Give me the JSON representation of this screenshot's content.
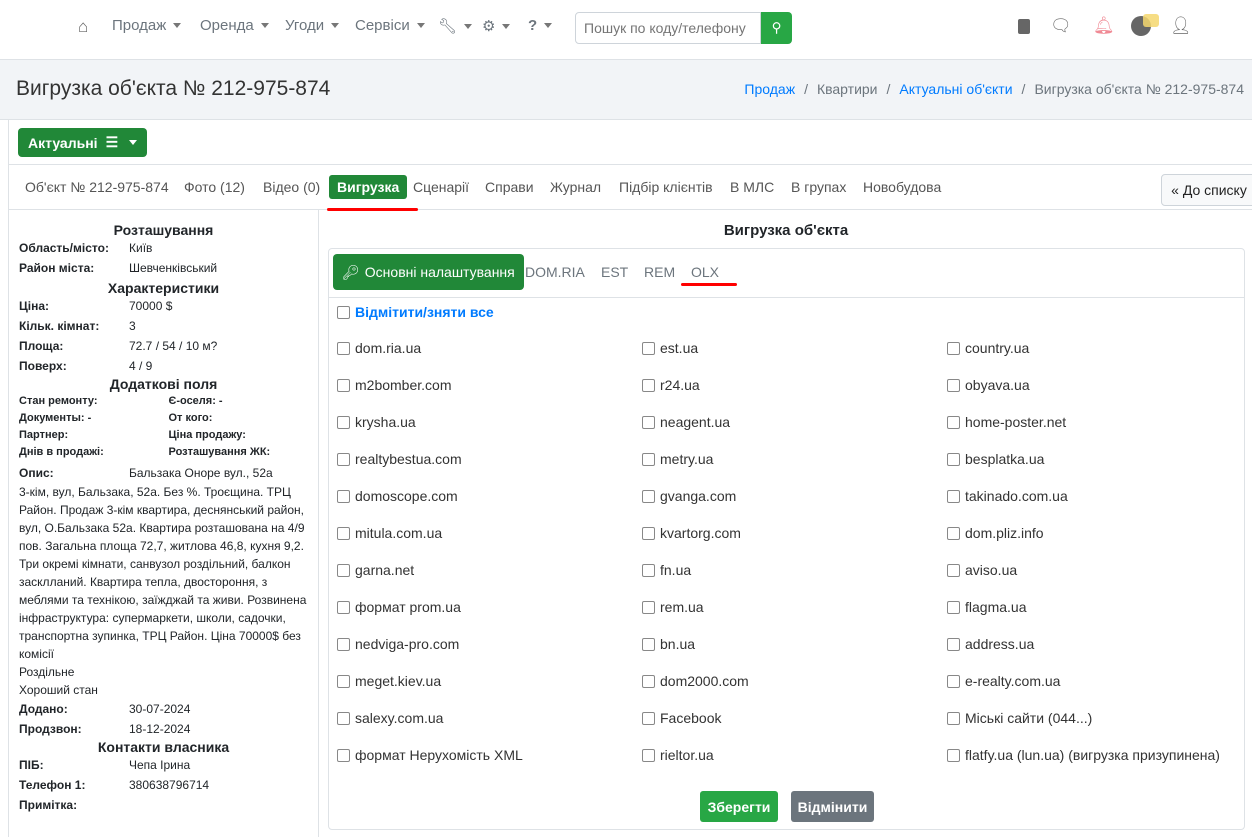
{
  "nav": {
    "items": [
      "Продаж",
      "Оренда",
      "Угоди",
      "Сервіси"
    ],
    "search_placeholder": "Пошук по коду/телефону"
  },
  "header": {
    "title": "Вигрузка об'єкта № 212-975-874",
    "breadcrumbs": [
      "Продаж",
      "Квартири",
      "Актуальні об'єкти",
      "Вигрузка об'єкта № 212-975-874"
    ]
  },
  "status_button": "Актуальні",
  "tabs": [
    "Об'єкт № 212-975-874",
    "Фото (12)",
    "Відео (0)",
    "Вигрузка",
    "Сценарії",
    "Справи",
    "Журнал",
    "Підбір клієнтів",
    "В МЛС",
    "В групах",
    "Новобудова"
  ],
  "back_button": "До списку",
  "left": {
    "location_title": "Розташування",
    "location": [
      {
        "k": "Область/місто:",
        "v": "Київ"
      },
      {
        "k": "Район міста:",
        "v": "Шевченківський"
      }
    ],
    "chars_title": "Характеристики",
    "chars": [
      {
        "k": "Ціна:",
        "v": "70000 $"
      },
      {
        "k": "Кільк. кімнат:",
        "v": "3"
      },
      {
        "k": "Площа:",
        "v": "72.7 / 54 / 10 м?"
      },
      {
        "k": "Поверх:",
        "v": "4 / 9"
      }
    ],
    "extra_title": "Додаткові поля",
    "extra": [
      [
        "Стан ремонту:",
        "Є-оселя: -"
      ],
      [
        "Документы: -",
        "От кого:"
      ],
      [
        "Партнер:",
        "Ціна продажу:"
      ],
      [
        "Днів в продажі:",
        "Розташування ЖК:"
      ]
    ],
    "desc_label": "Опис:",
    "desc_first": "Бальзака Оноре вул., 52а",
    "desc_text": "3-кім, вул, Бальзака, 52а. Без %. Троєщина. ТРЦ Район. Продаж 3-кім квартира, деснянський район, вул, О.Бальзака 52а. Квартира розташована на 4/9 пов. Загальна площа 72,7, житлова 46,8, кухня 9,2. Три окремі кімнати, санвузол роздільний, балкон засклланий. Квартира тепла, двостороння, з меблями та технікою, заїжджай та живи. Розвинена інфраструктура: супермаркети, школи, садочки, транспортна зупинка, ТРЦ Район. Ціна 70000$ без комісії",
    "desc_extra": [
      "Роздільне",
      "Хороший стан"
    ],
    "dates": [
      {
        "k": "Додано:",
        "v": "30-07-2024"
      },
      {
        "k": "Продзвон:",
        "v": "18-12-2024"
      }
    ],
    "contacts_title": "Контакти власника",
    "contacts": [
      {
        "k": "ПІБ:",
        "v": "Чепа Ірина"
      },
      {
        "k": "Телефон 1:",
        "v": "380638796714"
      },
      {
        "k": "Примітка:",
        "v": ""
      }
    ]
  },
  "right": {
    "title": "Вигрузка об'єкта",
    "tabs": [
      "Основні налаштування",
      "DOM.RIA",
      "EST",
      "REM",
      "OLX"
    ],
    "toggle_all": "Відмітити/зняти все",
    "sites": [
      "dom.ria.ua",
      "est.ua",
      "country.ua",
      "m2bomber.com",
      "r24.ua",
      "obyava.ua",
      "krysha.ua",
      "neagent.ua",
      "home-poster.net",
      "realtybestua.com",
      "metry.ua",
      "besplatka.ua",
      "domoscope.com",
      "gvanga.com",
      "takinado.com.ua",
      "mitula.com.ua",
      "kvartorg.com",
      "dom.pliz.info",
      "garna.net",
      "fn.ua",
      "aviso.ua",
      "формат prom.ua",
      "rem.ua",
      "flagma.ua",
      "nedviga-pro.com",
      "bn.ua",
      "address.ua",
      "meget.kiev.ua",
      "dom2000.com",
      "e-realty.com.ua",
      "salexy.com.ua",
      "Facebook",
      "Міські сайти (044...)",
      "формат Нерухомість XML",
      "rieltor.ua",
      "flatfy.ua (lun.ua) (вигрузка призупинена)"
    ],
    "save": "Зберегти",
    "cancel": "Відмінити"
  },
  "colors": {
    "green": "#218838",
    "link": "#007bff",
    "highlight": "#ff0000"
  }
}
